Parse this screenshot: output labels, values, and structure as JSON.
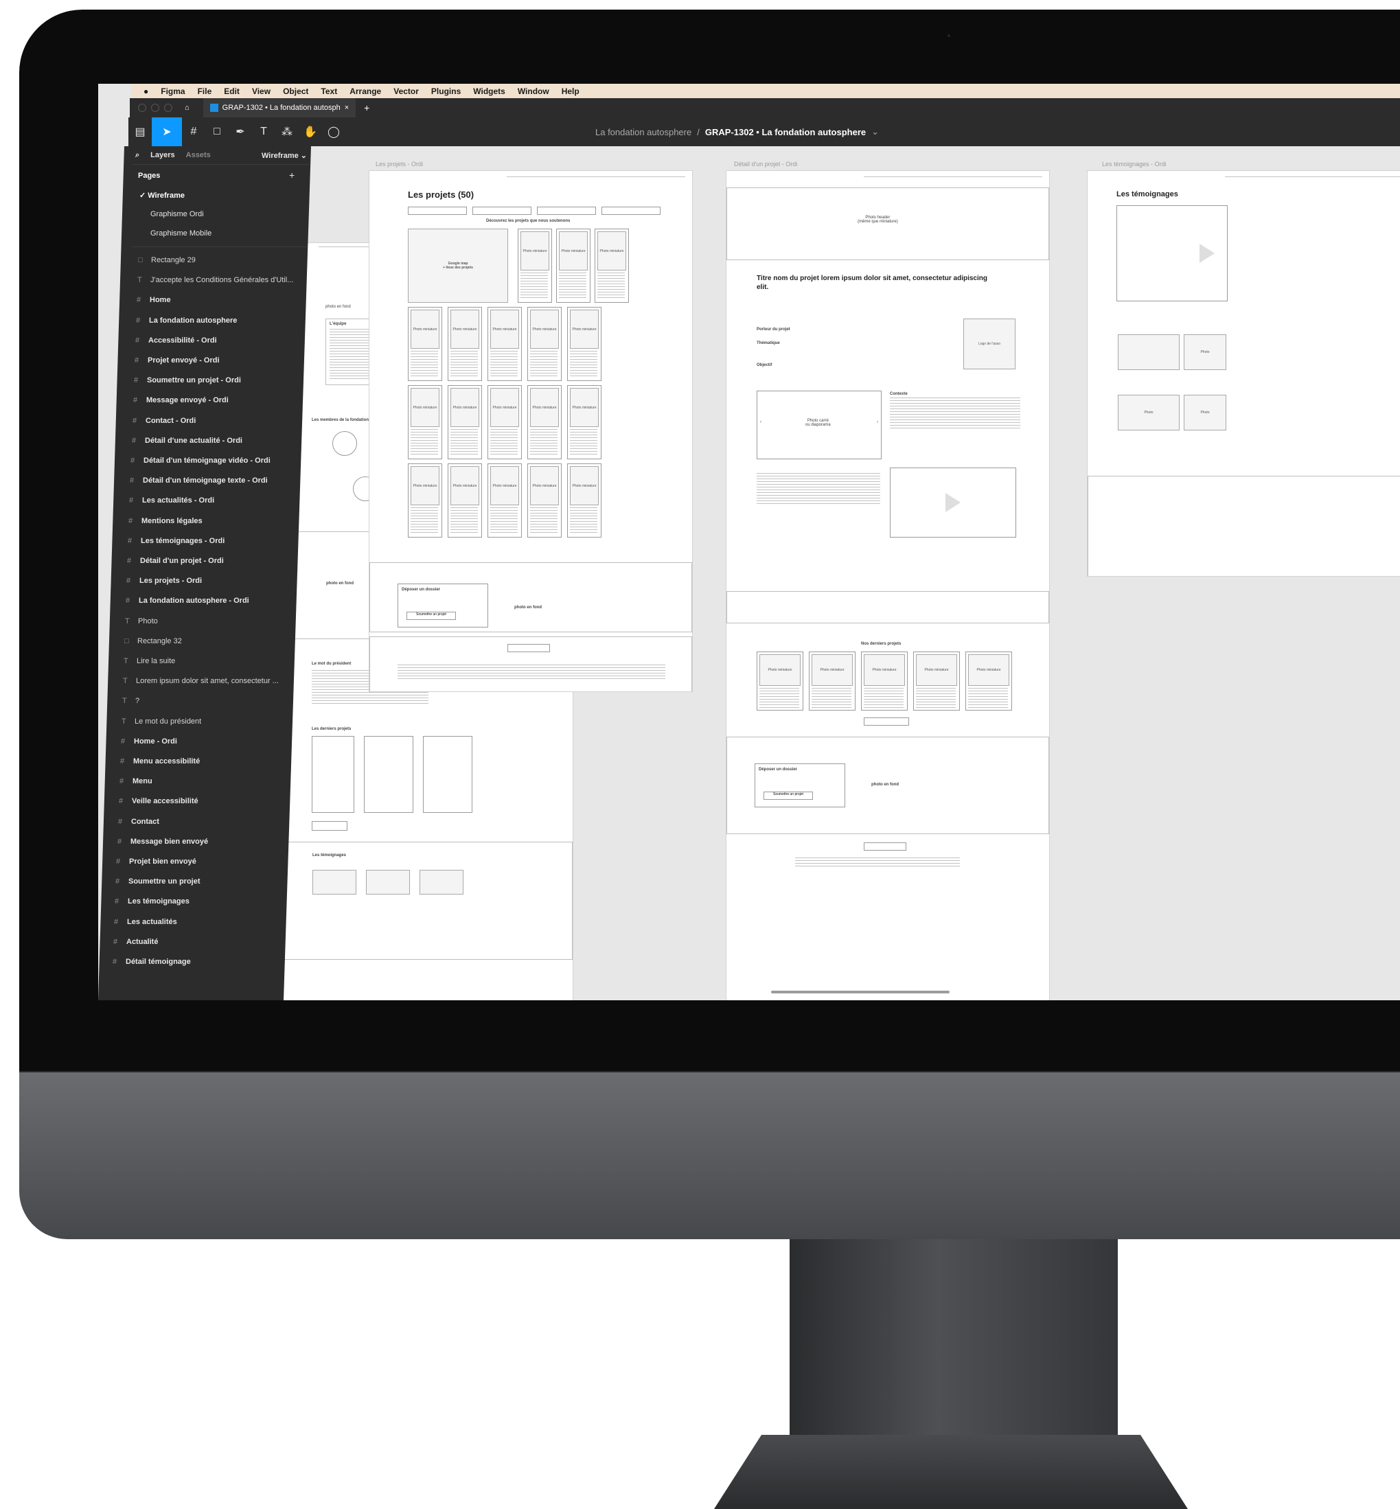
{
  "menubar": [
    "Figma",
    "File",
    "Edit",
    "View",
    "Object",
    "Text",
    "Arrange",
    "Vector",
    "Plugins",
    "Widgets",
    "Window",
    "Help"
  ],
  "tab": {
    "title": "GRAP-1302 • La fondation autosph",
    "close": "×",
    "new": "+"
  },
  "breadcrumb": {
    "project": "La fondation autosphere",
    "separator": "/",
    "file": "GRAP-1302 • La fondation autosphere",
    "chevron": "⌄"
  },
  "panel": {
    "tabs": {
      "layers": "Layers",
      "assets": "Assets",
      "page": "Wireframe ⌄"
    },
    "pages_title": "Pages",
    "add": "+",
    "pages": [
      "✓  Wireframe",
      "Graphisme Ordi",
      "Graphisme Mobile"
    ],
    "layers": [
      {
        "icon": "□",
        "name": "Rectangle 29",
        "type": "shape"
      },
      {
        "icon": "T",
        "name": "J'accepte les Conditions Générales d'Util...",
        "type": "text"
      },
      {
        "icon": "#",
        "name": "Home",
        "type": "frame"
      },
      {
        "icon": "#",
        "name": "La fondation autosphere",
        "type": "frame"
      },
      {
        "icon": "#",
        "name": "Accessibilité - Ordi",
        "type": "frame"
      },
      {
        "icon": "#",
        "name": "Projet envoyé - Ordi",
        "type": "frame"
      },
      {
        "icon": "#",
        "name": "Soumettre un projet - Ordi",
        "type": "frame"
      },
      {
        "icon": "#",
        "name": "Message envoyé - Ordi",
        "type": "frame"
      },
      {
        "icon": "#",
        "name": "Contact - Ordi",
        "type": "frame"
      },
      {
        "icon": "#",
        "name": "Détail d'une actualité - Ordi",
        "type": "frame"
      },
      {
        "icon": "#",
        "name": "Détail d'un témoignage vidéo - Ordi",
        "type": "frame"
      },
      {
        "icon": "#",
        "name": "Détail d'un témoignage texte - Ordi",
        "type": "frame"
      },
      {
        "icon": "#",
        "name": "Les actualités - Ordi",
        "type": "frame"
      },
      {
        "icon": "#",
        "name": "Mentions légales",
        "type": "frame"
      },
      {
        "icon": "#",
        "name": "Les témoignages - Ordi",
        "type": "frame"
      },
      {
        "icon": "#",
        "name": "Détail d'un projet - Ordi",
        "type": "frame"
      },
      {
        "icon": "#",
        "name": "Les projets - Ordi",
        "type": "frame"
      },
      {
        "icon": "#",
        "name": "La fondation autosphere - Ordi",
        "type": "frame"
      },
      {
        "icon": "T",
        "name": "Photo",
        "type": "text"
      },
      {
        "icon": "□",
        "name": "Rectangle 32",
        "type": "shape"
      },
      {
        "icon": "T",
        "name": "Lire la suite",
        "type": "text"
      },
      {
        "icon": "T",
        "name": "Lorem ipsum dolor sit amet, consectetur ...",
        "type": "text"
      },
      {
        "icon": "T",
        "name": "?",
        "type": "text"
      },
      {
        "icon": "T",
        "name": "Le mot du président",
        "type": "text"
      },
      {
        "icon": "#",
        "name": "Home - Ordi",
        "type": "frame"
      },
      {
        "icon": "#",
        "name": "Menu accessibilité",
        "type": "frame"
      },
      {
        "icon": "#",
        "name": "Menu",
        "type": "frame"
      },
      {
        "icon": "#",
        "name": "Veille accessibilité",
        "type": "frame"
      },
      {
        "icon": "#",
        "name": "Contact",
        "type": "frame"
      },
      {
        "icon": "#",
        "name": "Message bien envoyé",
        "type": "frame"
      },
      {
        "icon": "#",
        "name": "Projet bien envoyé",
        "type": "frame"
      },
      {
        "icon": "#",
        "name": "Soumettre un projet",
        "type": "frame"
      },
      {
        "icon": "#",
        "name": "Les témoignages",
        "type": "frame"
      },
      {
        "icon": "#",
        "name": "Les actualités",
        "type": "frame"
      },
      {
        "icon": "#",
        "name": "Actualité",
        "type": "frame"
      },
      {
        "icon": "#",
        "name": "Détail témoignage",
        "type": "frame"
      }
    ]
  },
  "canvas": {
    "frame_home": {
      "photo_fond": "photo en fond",
      "lequipe": "L'équipe",
      "membres": "Les membres de la fondation",
      "photo_fond2": "photo en fond",
      "mot": "Le mot du président",
      "derniers": "Les derniers projets",
      "temoignages": "Les témoignages"
    },
    "frame_projets": {
      "label": "Les projets - Ordi",
      "title": "Les projets (50)",
      "decouvrez": "Découvrez les projets que nous soutenons",
      "map": "Google map\n+ lieux des projets",
      "photo": "Photo miniature",
      "deposer": "Déposer un dossier",
      "soumettre": "Soumettre un projet",
      "photo_fond": "photo en fond"
    },
    "frame_detail": {
      "label": "Détail d'un projet - Ordi",
      "photo_header": "Photo header\n(même que miniature)",
      "title": "Titre nom du projet lorem ipsum dolor sit amet, consectetur adipiscing elit.",
      "logo": "Logo de l'asso",
      "porteur": "Porteur du projet",
      "thematique": "Thématique",
      "objectif": "Objectif",
      "contexte": "Contexte",
      "photo_carousel": "Photo carré\nou diaporama",
      "derniers": "Nos derniers projets",
      "deposer": "Déposer un dossier",
      "soumettre": "Soumettre un projet",
      "photo_fond": "photo en fond",
      "photo": "Photo miniature"
    },
    "frame_temoignages": {
      "label": "Les témoignages - Ordi",
      "title": "Les témoignages",
      "photo": "Photo"
    }
  }
}
